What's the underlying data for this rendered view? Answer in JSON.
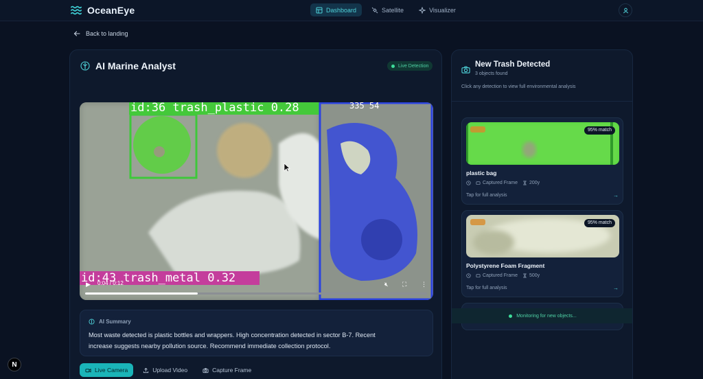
{
  "nav": {
    "brand": "OceanEye",
    "links": [
      {
        "label": "Dashboard",
        "icon": "dashboard-icon",
        "active": true
      },
      {
        "label": "Satellite",
        "icon": "satellite-icon",
        "active": false
      },
      {
        "label": "Visualizer",
        "icon": "sparkle-icon",
        "active": false
      }
    ]
  },
  "back": {
    "label": "Back to landing"
  },
  "analyst": {
    "title": "AI Marine Analyst",
    "badge": "Live Detection",
    "video": {
      "detections": [
        {
          "label": "id:36 trash_plastic 0.28"
        },
        {
          "label": "id:43 trash_metal 0.32"
        }
      ],
      "overlay_numbers": "335 54",
      "time": "0:04 / 0:12",
      "progress": 0.33
    },
    "summary": {
      "heading": "AI Summary",
      "text": "Most waste detected is plastic bottles and wrappers. High concentration detected in sector B-7. Recent increase suggests nearby pollution source. Recommend immediate collection protocol."
    },
    "actions": [
      {
        "label": "Live Camera",
        "icon": "video-camera-icon",
        "primary": true
      },
      {
        "label": "Upload Video",
        "icon": "upload-icon",
        "primary": false
      },
      {
        "label": "Capture Frame",
        "icon": "camera-icon",
        "primary": false
      }
    ]
  },
  "detections_panel": {
    "title": "New Trash Detected",
    "subtitle": "3 objects found",
    "hint": "Click any detection to view full environmental analysis",
    "cards": [
      {
        "name": "plastic bag",
        "match": "95% match",
        "source": "Captured Frame",
        "age": "200y",
        "tap": "Tap for full analysis",
        "arrow": "→"
      },
      {
        "name": "Polystyrene Foam Fragment",
        "match": "95% match",
        "source": "Captured Frame",
        "age": "500y",
        "tap": "Tap for full analysis",
        "arrow": "→"
      }
    ],
    "monitor": "Monitoring for new objects..."
  },
  "corner_badge": "N",
  "colors": {
    "accent": "#1ab4b8",
    "live_green": "#3ddc9a",
    "panel": "#0e192c",
    "background": "#0a1222"
  }
}
